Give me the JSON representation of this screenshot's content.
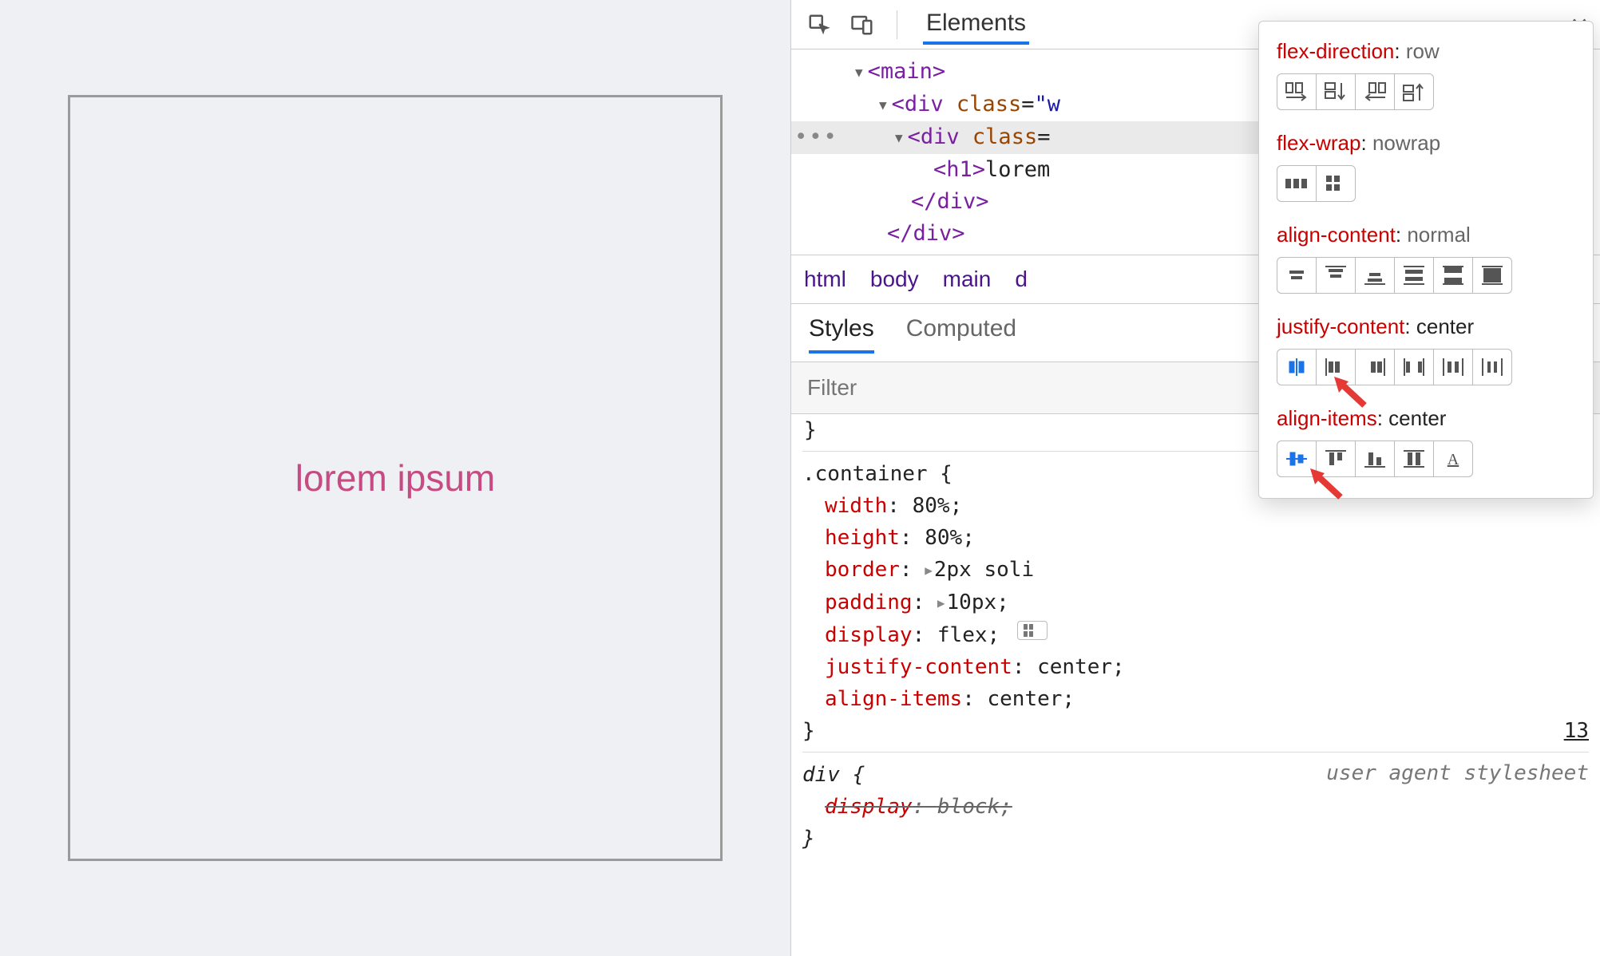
{
  "viewport": {
    "text": "lorem ipsum"
  },
  "toolbar": {
    "tab": "Elements"
  },
  "dom": {
    "main_open": "<main>",
    "div1_open": "<div class=\"w",
    "div2_open": "<div class=",
    "h1_open": "<h1>",
    "h1_text": "lorem",
    "div_close": "</div>",
    "div_close2": "</div>"
  },
  "crumbs": [
    "html",
    "body",
    "main",
    "d"
  ],
  "subtabs": {
    "styles": "Styles",
    "computed": "Computed"
  },
  "filter_placeholder": "Filter",
  "rules": {
    "container": {
      "selector": ".container {",
      "brace_close": "}",
      "props": [
        {
          "n": "width",
          "v": "80%",
          "sep": ": ",
          "end": ";"
        },
        {
          "n": "height",
          "v": "80%",
          "sep": ": ",
          "end": ";"
        },
        {
          "n": "border",
          "v": "2px soli",
          "sep": ": ",
          "end": "",
          "expand": true
        },
        {
          "n": "padding",
          "v": "10px",
          "sep": ": ",
          "end": ";",
          "expand": true
        },
        {
          "n": "display",
          "v": "flex",
          "sep": ": ",
          "end": ";",
          "badge": true
        },
        {
          "n": "justify-content",
          "v": "center",
          "sep": ": ",
          "end": ";"
        },
        {
          "n": "align-items",
          "v": "center",
          "sep": ": ",
          "end": ";"
        }
      ],
      "link": "13"
    },
    "div": {
      "selector": "div {",
      "brace_close": "}",
      "uas": "user agent stylesheet",
      "props": [
        {
          "n": "display",
          "v": "block",
          "sep": ": ",
          "end": ";",
          "strike": true
        }
      ]
    }
  },
  "popover": {
    "flex_direction": {
      "label": "flex-direction",
      "value": "row"
    },
    "flex_wrap": {
      "label": "flex-wrap",
      "value": "nowrap"
    },
    "align_content": {
      "label": "align-content",
      "value": "normal"
    },
    "justify_content": {
      "label": "justify-content",
      "value": "center",
      "selected": 0
    },
    "align_items": {
      "label": "align-items",
      "value": "center",
      "selected": 0
    }
  }
}
